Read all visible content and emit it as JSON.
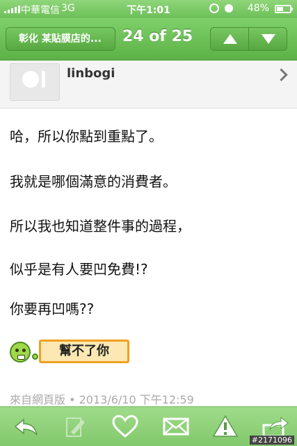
{
  "status": {
    "carrier": "中華電信",
    "network": "3G",
    "time": "下午1:01",
    "battery": "48%",
    "battery_level": 0.48
  },
  "nav": {
    "back_label": "彰化 某貼膜店的...",
    "counter": "24 of 25",
    "up_icon": "arrow-up-icon",
    "down_icon": "arrow-down-icon"
  },
  "author": {
    "name": "linbogi"
  },
  "post": {
    "lines": [
      "哈，所以你點到重點了。",
      "我就是哪個滿意的消費者。",
      "所以我也知道整件事的過程，",
      "似乎是有人要凹免費!?",
      "你要再凹嗎??"
    ],
    "sticker_text": "幫不了你",
    "source": "來自網頁版 • 2013/6/10 下午12:59"
  },
  "toolbar": {
    "items": [
      "reply-icon",
      "edit-icon",
      "heart-icon",
      "mail-icon",
      "warning-icon",
      "share-icon"
    ]
  },
  "watermark": "#2171096",
  "colors": {
    "accent": "#6dbf58",
    "sticker_border": "#f0a020",
    "sticker_bg": "#fbe8b2"
  }
}
